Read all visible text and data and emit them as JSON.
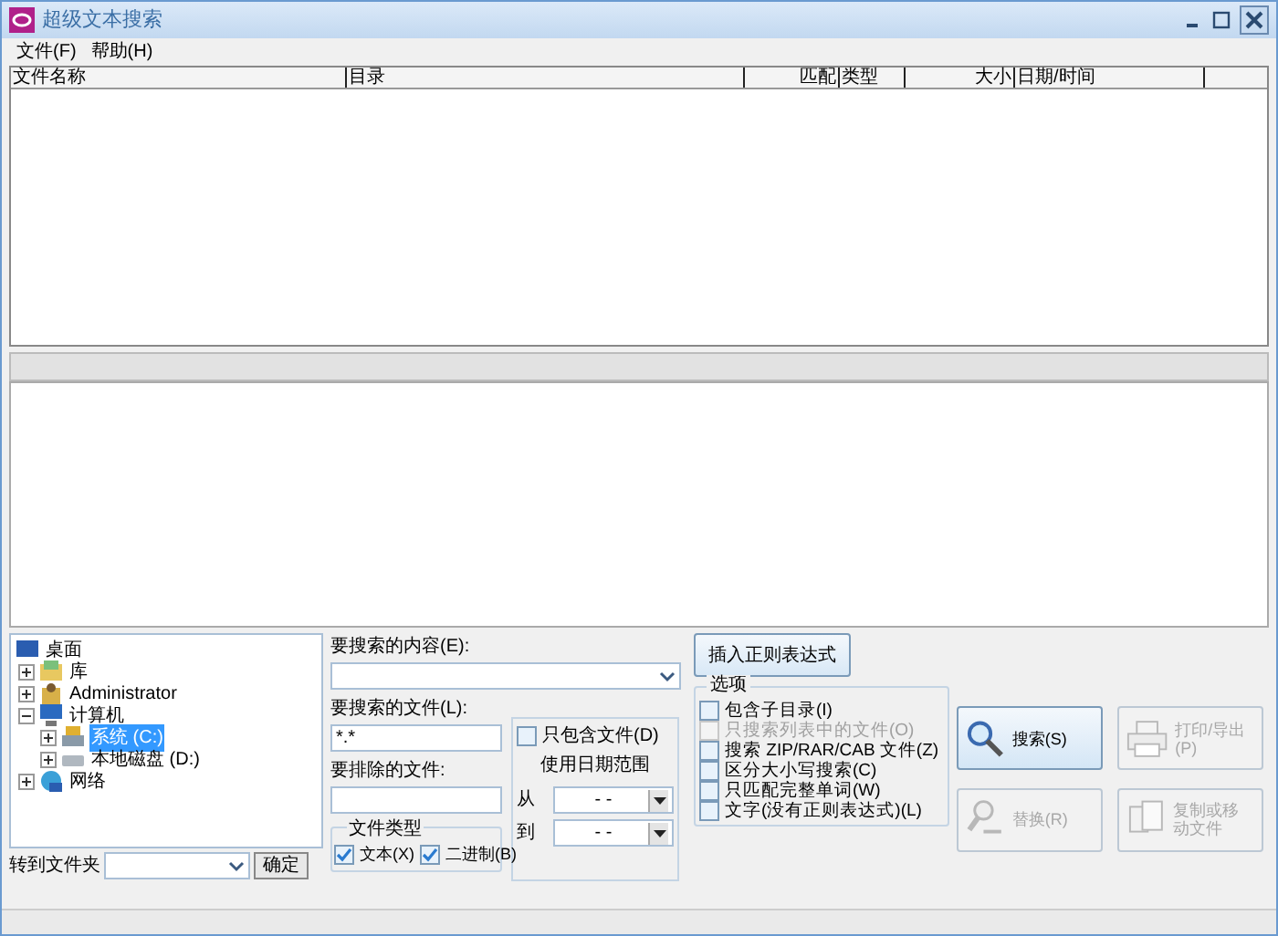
{
  "window": {
    "title": "超级文本搜索"
  },
  "menu": [
    "文件(F)",
    "帮助(H)"
  ],
  "results": {
    "columns": [
      "文件名称",
      "目录",
      "匹配",
      "类型",
      "大小",
      "日期/时间"
    ]
  },
  "tree": [
    {
      "label": "桌面",
      "kind": "desktop",
      "selected": false,
      "children": [
        {
          "label": "库",
          "kind": "library",
          "selected": false,
          "expanded": false
        },
        {
          "label": "Administrator",
          "kind": "user",
          "selected": false,
          "expanded": false
        },
        {
          "label": "计算机",
          "kind": "computer",
          "selected": false,
          "expanded": true,
          "children": [
            {
              "label": "系统 (C:)",
              "kind": "drive",
              "selected": true,
              "expanded": false
            },
            {
              "label": "本地磁盘 (D:)",
              "kind": "disk",
              "selected": false,
              "expanded": false
            }
          ]
        },
        {
          "label": "网络",
          "kind": "network",
          "selected": false,
          "expanded": false
        }
      ]
    }
  ],
  "goto": {
    "label": "转到文件夹",
    "button": "确定"
  },
  "search_content": {
    "label": "要搜索的内容(E):"
  },
  "search_files": {
    "label": "要搜索的文件(L):",
    "value": "*.*"
  },
  "exclude_files": {
    "label": "要排除的文件:"
  },
  "file_type": {
    "title": "文件类型",
    "options": [
      {
        "label": "文本(X)",
        "checked": true
      },
      {
        "label": "二进制(B)",
        "checked": true
      }
    ]
  },
  "date": {
    "only": {
      "label": "只包含文件(D)",
      "checked": false
    },
    "caption": "使用日期范围",
    "from": {
      "label": "从",
      "value": "-  -"
    },
    "to": {
      "label": "到",
      "value": "-  -"
    }
  },
  "regex_button": "插入正则表达式",
  "options": {
    "title": "选项",
    "items": [
      {
        "label": "包含子目录(I)",
        "checked": false,
        "disabled": false
      },
      {
        "label": "只搜索列表中的文件(O)",
        "checked": false,
        "disabled": true
      },
      {
        "label": "搜索 ZIP/RAR/CAB 文件(Z)",
        "checked": false,
        "disabled": false
      },
      {
        "label": "区分大小写搜索(C)",
        "checked": false,
        "disabled": false
      },
      {
        "label": "只匹配完整单词(W)",
        "checked": false,
        "disabled": false
      },
      {
        "label": "文字(没有正则表达式)(L)",
        "checked": false,
        "disabled": false
      }
    ]
  },
  "actions": [
    {
      "label": "搜索(S)",
      "kind": "search",
      "disabled": false
    },
    {
      "label": "打印/导出(P)",
      "kind": "printer",
      "disabled": true
    },
    {
      "label": "替换(R)",
      "kind": "replace",
      "disabled": true
    },
    {
      "label": "复制或移动文件",
      "kind": "copy",
      "disabled": true
    }
  ]
}
